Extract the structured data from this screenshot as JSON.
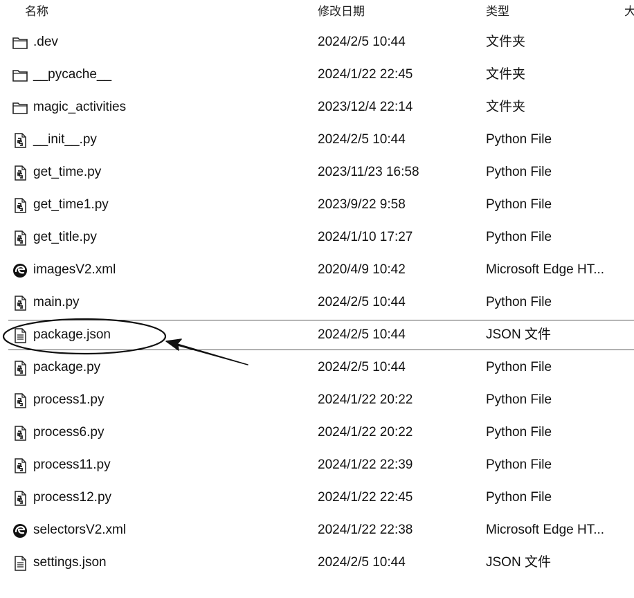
{
  "columns": {
    "name": "名称",
    "date": "修改日期",
    "type": "类型",
    "size": "大"
  },
  "files": [
    {
      "name": ".dev",
      "date": "2024/2/5 10:44",
      "type": "文件夹",
      "icon": "folder-icon"
    },
    {
      "name": "__pycache__",
      "date": "2024/1/22 22:45",
      "type": "文件夹",
      "icon": "folder-icon"
    },
    {
      "name": "magic_activities",
      "date": "2023/12/4 22:14",
      "type": "文件夹",
      "icon": "folder-icon"
    },
    {
      "name": "__init__.py",
      "date": "2024/2/5 10:44",
      "type": "Python File",
      "icon": "python-file-icon"
    },
    {
      "name": "get_time.py",
      "date": "2023/11/23 16:58",
      "type": "Python File",
      "icon": "python-file-icon"
    },
    {
      "name": "get_time1.py",
      "date": "2023/9/22 9:58",
      "type": "Python File",
      "icon": "python-file-icon"
    },
    {
      "name": "get_title.py",
      "date": "2024/1/10 17:27",
      "type": "Python File",
      "icon": "python-file-icon"
    },
    {
      "name": "imagesV2.xml",
      "date": "2020/4/9 10:42",
      "type": "Microsoft Edge HT...",
      "icon": "edge-icon"
    },
    {
      "name": "main.py",
      "date": "2024/2/5 10:44",
      "type": "Python File",
      "icon": "python-file-icon"
    },
    {
      "name": "package.json",
      "date": "2024/2/5 10:44",
      "type": "JSON 文件",
      "icon": "json-file-icon",
      "selected": true
    },
    {
      "name": "package.py",
      "date": "2024/2/5 10:44",
      "type": "Python File",
      "icon": "python-file-icon"
    },
    {
      "name": "process1.py",
      "date": "2024/1/22 20:22",
      "type": "Python File",
      "icon": "python-file-icon"
    },
    {
      "name": "process6.py",
      "date": "2024/1/22 20:22",
      "type": "Python File",
      "icon": "python-file-icon"
    },
    {
      "name": "process11.py",
      "date": "2024/1/22 22:39",
      "type": "Python File",
      "icon": "python-file-icon"
    },
    {
      "name": "process12.py",
      "date": "2024/1/22 22:45",
      "type": "Python File",
      "icon": "python-file-icon"
    },
    {
      "name": "selectorsV2.xml",
      "date": "2024/1/22 22:38",
      "type": "Microsoft Edge HT...",
      "icon": "edge-icon"
    },
    {
      "name": "settings.json",
      "date": "2024/2/5 10:44",
      "type": "JSON 文件",
      "icon": "json-file-icon"
    }
  ]
}
